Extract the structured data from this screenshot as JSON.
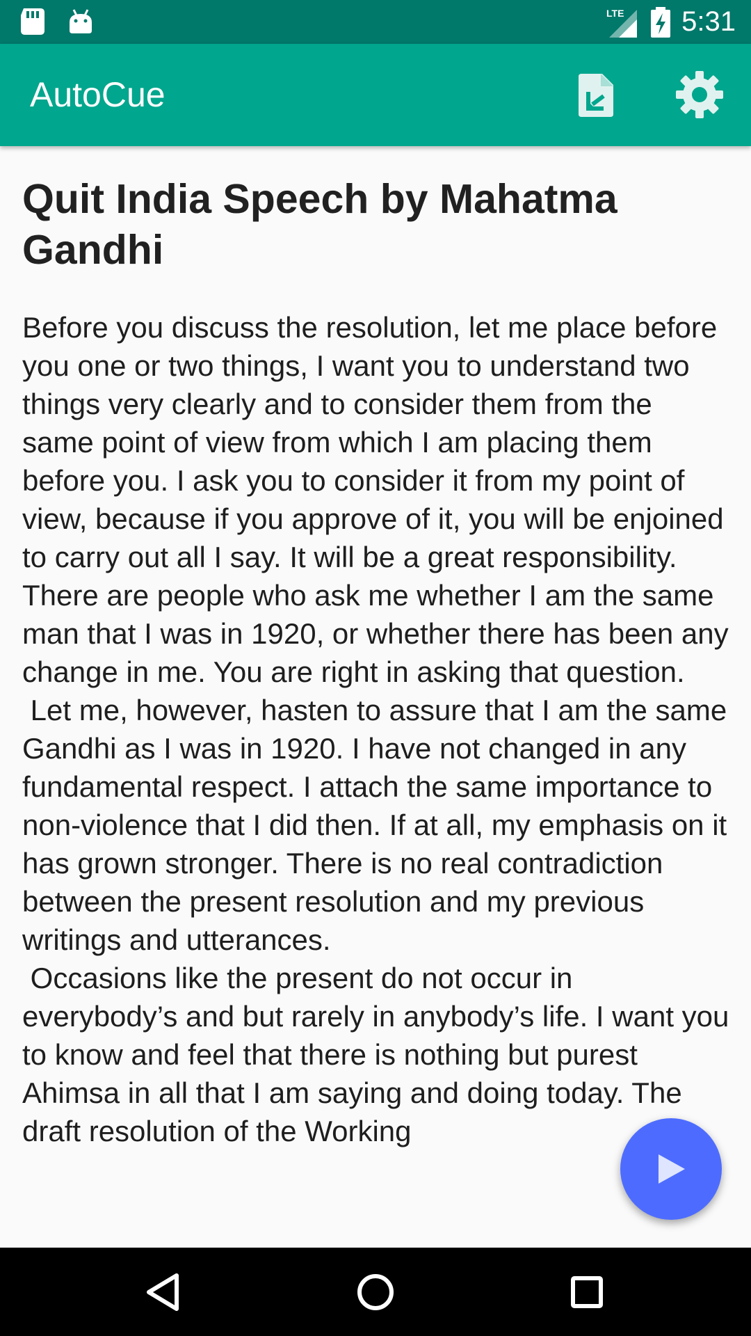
{
  "status_bar": {
    "time": "5:31",
    "network": "LTE",
    "icons": [
      "sd-card-icon",
      "android-icon",
      "lte-signal-icon",
      "battery-charging-icon"
    ]
  },
  "app_bar": {
    "title": "AutoCue",
    "actions": [
      "file-import-icon",
      "gear-icon"
    ],
    "color": "#00a68d"
  },
  "speech": {
    "title": "Quit India Speech by Mahatma Gandhi",
    "body": "Before you discuss the resolution, let me place before you one or two things, I want you to understand two things very clearly and to consider them from the same point of view from which I am placing them before you. I ask you to consider it from my point of view, because if you approve of it, you will be enjoined to carry out all I say. It will be a great responsibility. There are people who ask me whether I am the same man that I was in 1920, or whether there has been any change in me. You are right in asking that question.\n Let me, however, hasten to assure that I am the same Gandhi as I was in 1920. I have not changed in any fundamental respect. I attach the same importance to non-violence that I did then. If at all, my emphasis on it has grown stronger. There is no real contradiction between the present resolution and my previous writings and utterances.\n Occasions like the present do not occur in everybody’s and but rarely in anybody’s life. I want you to know and feel that there is nothing but purest Ahimsa in all that I am saying and doing today. The draft resolution of the Working"
  },
  "fab": {
    "icon": "play-icon",
    "color": "#4d6cff"
  },
  "nav_bar": {
    "icons": [
      "back-icon",
      "home-icon",
      "recents-icon"
    ]
  }
}
